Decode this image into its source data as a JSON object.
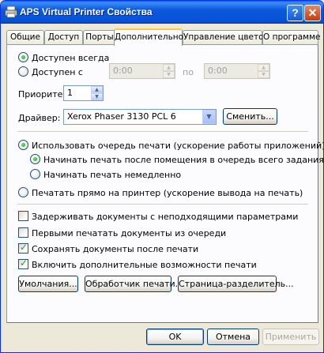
{
  "window": {
    "title": "APS Virtual Printer Свойства",
    "help_glyph": "?",
    "close_glyph": "✕"
  },
  "tabs": [
    {
      "label": "Общие"
    },
    {
      "label": "Доступ"
    },
    {
      "label": "Порты"
    },
    {
      "label": "Дополнительно",
      "active": true
    },
    {
      "label": "Управление цветом"
    },
    {
      "label": "О программе"
    }
  ],
  "availability": {
    "always_label": "Доступен всегда",
    "from_label": "Доступен с",
    "from_time": "0:00",
    "to_label": "по",
    "to_time": "0:00"
  },
  "priority": {
    "label": "Приоритет:",
    "value": "1"
  },
  "driver": {
    "label": "Драйвер:",
    "value": "Xerox Phaser 3130 PCL 6",
    "change_button": "Сменить..."
  },
  "spool": {
    "use_queue_label": "Использовать очередь печати (ускорение работы приложений)",
    "after_last_page_label": "Начинать печать после помещения в очередь всего задания",
    "immediately_label": "Начинать печать немедленно",
    "direct_label": "Печатать прямо на принтер (ускорение вывода на печать)"
  },
  "options": [
    {
      "label": "Задерживать документы с неподходящими параметрами",
      "checked": false
    },
    {
      "label": "Первыми печатать документы из очереди",
      "checked": false
    },
    {
      "label": "Сохранять документы после печати",
      "checked": true
    },
    {
      "label": "Включить дополнительные возможности печати",
      "checked": true
    }
  ],
  "panel_buttons": {
    "defaults": "Умолчания...",
    "processor": "Обработчик печати...",
    "separator_page": "Страница-разделитель..."
  },
  "dialog_buttons": {
    "ok": "OK",
    "cancel": "Отмена",
    "apply": "Применить"
  }
}
